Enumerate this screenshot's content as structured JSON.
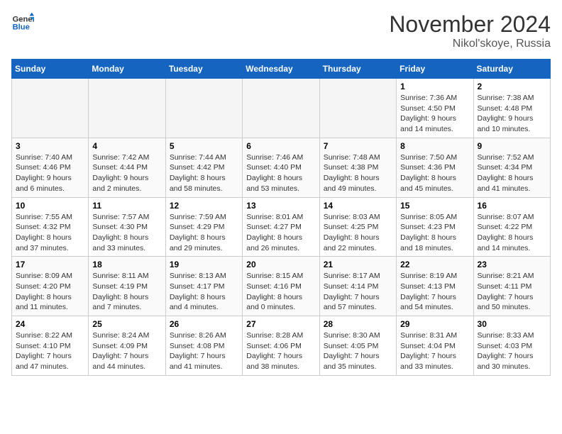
{
  "header": {
    "logo_line1": "General",
    "logo_line2": "Blue",
    "month_title": "November 2024",
    "location": "Nikol'skoye, Russia"
  },
  "days_of_week": [
    "Sunday",
    "Monday",
    "Tuesday",
    "Wednesday",
    "Thursday",
    "Friday",
    "Saturday"
  ],
  "weeks": [
    [
      {
        "day": "",
        "info": ""
      },
      {
        "day": "",
        "info": ""
      },
      {
        "day": "",
        "info": ""
      },
      {
        "day": "",
        "info": ""
      },
      {
        "day": "",
        "info": ""
      },
      {
        "day": "1",
        "info": "Sunrise: 7:36 AM\nSunset: 4:50 PM\nDaylight: 9 hours and 14 minutes."
      },
      {
        "day": "2",
        "info": "Sunrise: 7:38 AM\nSunset: 4:48 PM\nDaylight: 9 hours and 10 minutes."
      }
    ],
    [
      {
        "day": "3",
        "info": "Sunrise: 7:40 AM\nSunset: 4:46 PM\nDaylight: 9 hours and 6 minutes."
      },
      {
        "day": "4",
        "info": "Sunrise: 7:42 AM\nSunset: 4:44 PM\nDaylight: 9 hours and 2 minutes."
      },
      {
        "day": "5",
        "info": "Sunrise: 7:44 AM\nSunset: 4:42 PM\nDaylight: 8 hours and 58 minutes."
      },
      {
        "day": "6",
        "info": "Sunrise: 7:46 AM\nSunset: 4:40 PM\nDaylight: 8 hours and 53 minutes."
      },
      {
        "day": "7",
        "info": "Sunrise: 7:48 AM\nSunset: 4:38 PM\nDaylight: 8 hours and 49 minutes."
      },
      {
        "day": "8",
        "info": "Sunrise: 7:50 AM\nSunset: 4:36 PM\nDaylight: 8 hours and 45 minutes."
      },
      {
        "day": "9",
        "info": "Sunrise: 7:52 AM\nSunset: 4:34 PM\nDaylight: 8 hours and 41 minutes."
      }
    ],
    [
      {
        "day": "10",
        "info": "Sunrise: 7:55 AM\nSunset: 4:32 PM\nDaylight: 8 hours and 37 minutes."
      },
      {
        "day": "11",
        "info": "Sunrise: 7:57 AM\nSunset: 4:30 PM\nDaylight: 8 hours and 33 minutes."
      },
      {
        "day": "12",
        "info": "Sunrise: 7:59 AM\nSunset: 4:29 PM\nDaylight: 8 hours and 29 minutes."
      },
      {
        "day": "13",
        "info": "Sunrise: 8:01 AM\nSunset: 4:27 PM\nDaylight: 8 hours and 26 minutes."
      },
      {
        "day": "14",
        "info": "Sunrise: 8:03 AM\nSunset: 4:25 PM\nDaylight: 8 hours and 22 minutes."
      },
      {
        "day": "15",
        "info": "Sunrise: 8:05 AM\nSunset: 4:23 PM\nDaylight: 8 hours and 18 minutes."
      },
      {
        "day": "16",
        "info": "Sunrise: 8:07 AM\nSunset: 4:22 PM\nDaylight: 8 hours and 14 minutes."
      }
    ],
    [
      {
        "day": "17",
        "info": "Sunrise: 8:09 AM\nSunset: 4:20 PM\nDaylight: 8 hours and 11 minutes."
      },
      {
        "day": "18",
        "info": "Sunrise: 8:11 AM\nSunset: 4:19 PM\nDaylight: 8 hours and 7 minutes."
      },
      {
        "day": "19",
        "info": "Sunrise: 8:13 AM\nSunset: 4:17 PM\nDaylight: 8 hours and 4 minutes."
      },
      {
        "day": "20",
        "info": "Sunrise: 8:15 AM\nSunset: 4:16 PM\nDaylight: 8 hours and 0 minutes."
      },
      {
        "day": "21",
        "info": "Sunrise: 8:17 AM\nSunset: 4:14 PM\nDaylight: 7 hours and 57 minutes."
      },
      {
        "day": "22",
        "info": "Sunrise: 8:19 AM\nSunset: 4:13 PM\nDaylight: 7 hours and 54 minutes."
      },
      {
        "day": "23",
        "info": "Sunrise: 8:21 AM\nSunset: 4:11 PM\nDaylight: 7 hours and 50 minutes."
      }
    ],
    [
      {
        "day": "24",
        "info": "Sunrise: 8:22 AM\nSunset: 4:10 PM\nDaylight: 7 hours and 47 minutes."
      },
      {
        "day": "25",
        "info": "Sunrise: 8:24 AM\nSunset: 4:09 PM\nDaylight: 7 hours and 44 minutes."
      },
      {
        "day": "26",
        "info": "Sunrise: 8:26 AM\nSunset: 4:08 PM\nDaylight: 7 hours and 41 minutes."
      },
      {
        "day": "27",
        "info": "Sunrise: 8:28 AM\nSunset: 4:06 PM\nDaylight: 7 hours and 38 minutes."
      },
      {
        "day": "28",
        "info": "Sunrise: 8:30 AM\nSunset: 4:05 PM\nDaylight: 7 hours and 35 minutes."
      },
      {
        "day": "29",
        "info": "Sunrise: 8:31 AM\nSunset: 4:04 PM\nDaylight: 7 hours and 33 minutes."
      },
      {
        "day": "30",
        "info": "Sunrise: 8:33 AM\nSunset: 4:03 PM\nDaylight: 7 hours and 30 minutes."
      }
    ]
  ]
}
